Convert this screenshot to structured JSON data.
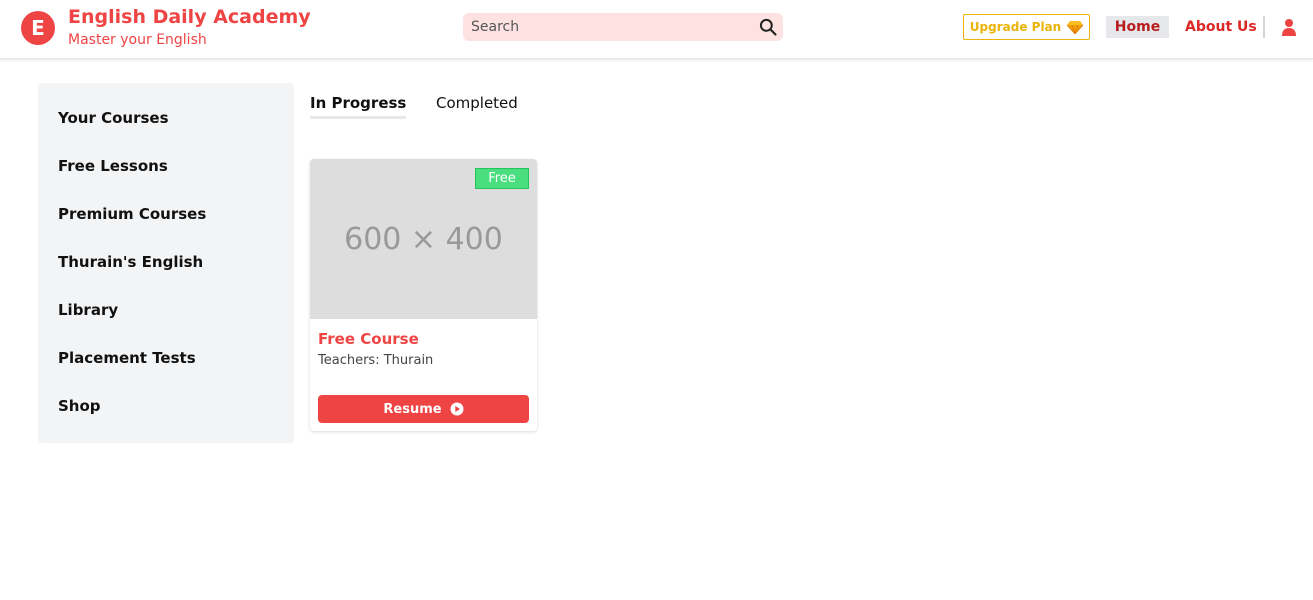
{
  "header": {
    "logo_letter": "E",
    "title": "English Daily Academy",
    "subtitle": "Master your English",
    "search_placeholder": "Search",
    "upgrade_label": "Upgrade Plan",
    "nav": {
      "home": "Home",
      "about": "About Us"
    }
  },
  "sidebar": {
    "items": [
      {
        "label": "Your Courses"
      },
      {
        "label": "Free Lessons"
      },
      {
        "label": "Premium Courses"
      },
      {
        "label": "Thurain's English"
      },
      {
        "label": "Library"
      },
      {
        "label": "Placement Tests"
      },
      {
        "label": "Shop"
      }
    ]
  },
  "tabs": [
    {
      "label": "In Progress",
      "active": true
    },
    {
      "label": "Completed",
      "active": false
    }
  ],
  "course_card": {
    "image_placeholder": "600 × 400",
    "badge": "Free",
    "title": "Free Course",
    "teachers": "Teachers: Thurain",
    "button_label": "Resume"
  },
  "colors": {
    "brand": "#ef4444",
    "search_bg": "#fee2e2",
    "upgrade": "#eab308",
    "badge": "#4ade80",
    "sidebar_bg": "#f3f4f6"
  },
  "icons": {
    "search": "search-icon",
    "upgrade": "gem-icon",
    "user": "user-icon",
    "resume": "play-circle-icon"
  }
}
